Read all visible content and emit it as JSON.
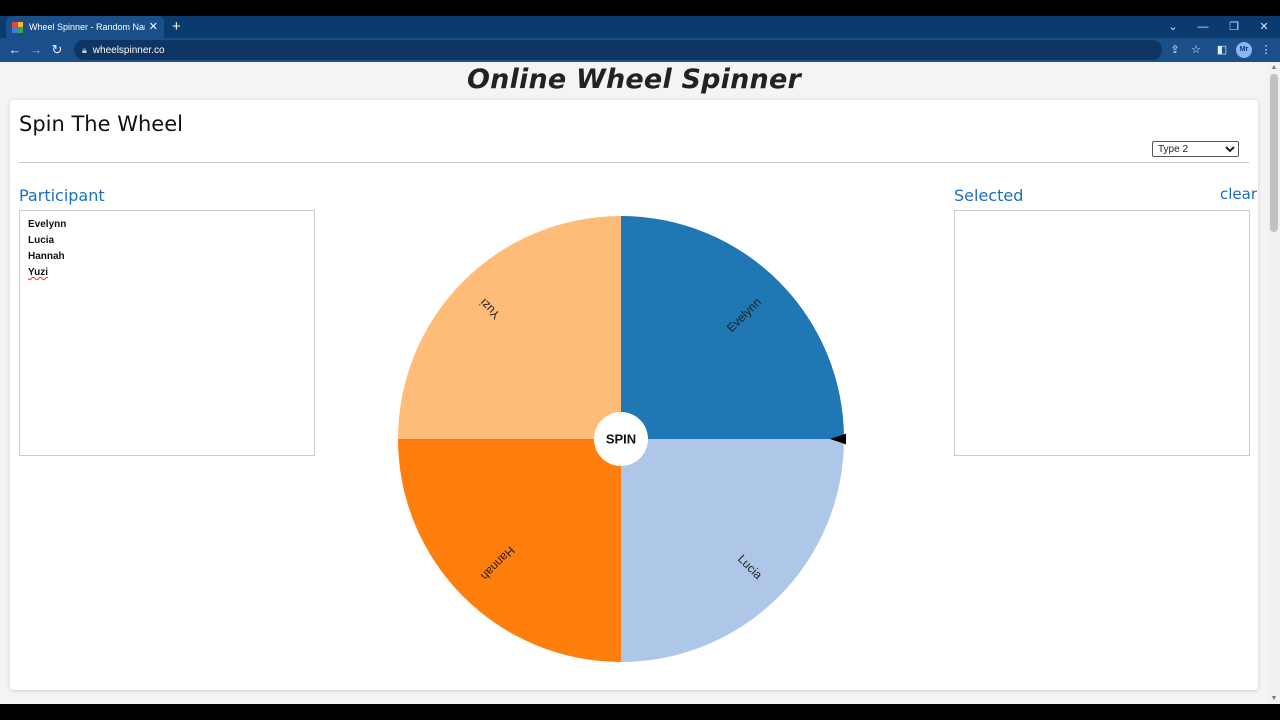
{
  "browser": {
    "tab_title": "Wheel Spinner - Random Name",
    "url": "wheelspinner.co",
    "profile_initials": "Mr"
  },
  "page": {
    "heading": "Online Wheel Spinner",
    "card_title": "Spin The Wheel",
    "type_select": {
      "selected": "Type 2"
    },
    "participant_label": "Participant",
    "participants": [
      "Evelynn",
      "Lucia",
      "Hannah",
      "Yuzi"
    ],
    "selected_label": "Selected",
    "clear_label": "clear"
  },
  "wheel": {
    "spin_label": "SPIN",
    "segments": [
      {
        "label": "Evelynn",
        "color": "#1f77b4"
      },
      {
        "label": "Lucia",
        "color": "#aec7e8"
      },
      {
        "label": "Hannah",
        "color": "#ff7f0e"
      },
      {
        "label": "Yuzi",
        "color": "#ffbb78"
      }
    ]
  },
  "icons": {
    "back": "arrow-left-icon",
    "forward": "arrow-right-icon",
    "reload": "reload-icon",
    "lock": "lock-icon",
    "share": "share-icon",
    "star": "star-icon",
    "sidepanel": "side-panel-icon",
    "menu": "kebab-menu-icon",
    "pointer": "pointer-triangle-icon"
  }
}
